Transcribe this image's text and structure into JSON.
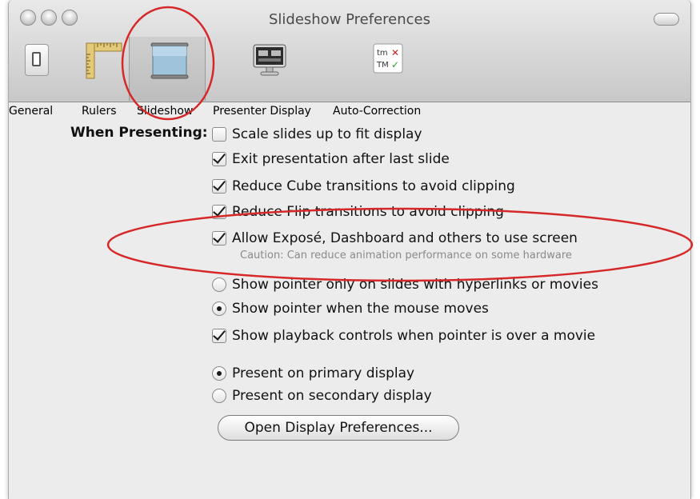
{
  "window": {
    "title": "Slideshow Preferences"
  },
  "toolbar": {
    "items": [
      {
        "label": "General",
        "icon": "switch-icon",
        "selected": false
      },
      {
        "label": "Rulers",
        "icon": "ruler-icon",
        "selected": false
      },
      {
        "label": "Slideshow",
        "icon": "projector-screen-icon",
        "selected": true
      },
      {
        "label": "Presenter Display",
        "icon": "display-icon",
        "selected": false
      },
      {
        "label": "Auto-Correction",
        "icon": "autocorrect-icon",
        "selected": false
      }
    ],
    "autocorrect_icon_text": {
      "top": "tm",
      "bottom": "TM"
    }
  },
  "prefs": {
    "section_label": "When Presenting:",
    "options": [
      {
        "type": "checkbox",
        "label": "Scale slides up to fit display",
        "checked": false
      },
      {
        "type": "checkbox",
        "label": "Exit presentation after last slide",
        "checked": true
      },
      {
        "type": "checkbox",
        "label": "Reduce Cube transitions to avoid clipping",
        "checked": true
      },
      {
        "type": "checkbox",
        "label": "Reduce Flip transitions to avoid clipping",
        "checked": true
      },
      {
        "type": "checkbox",
        "label": "Allow Exposé, Dashboard and others to use screen",
        "checked": true
      },
      {
        "type": "radio",
        "label": "Show pointer only on slides with hyperlinks or movies",
        "checked": false
      },
      {
        "type": "radio",
        "label": "Show pointer when the mouse moves",
        "checked": true
      },
      {
        "type": "checkbox",
        "label": "Show playback controls when pointer is over a movie",
        "checked": true
      },
      {
        "type": "radio",
        "label": "Present on primary display",
        "checked": true
      },
      {
        "type": "radio",
        "label": "Present on secondary display",
        "checked": false
      }
    ],
    "caution": "Caution: Can reduce animation performance on some hardware",
    "button_label": "Open Display Preferences..."
  },
  "colors": {
    "annotation": "#d62828",
    "window_bg": "#ececec"
  }
}
